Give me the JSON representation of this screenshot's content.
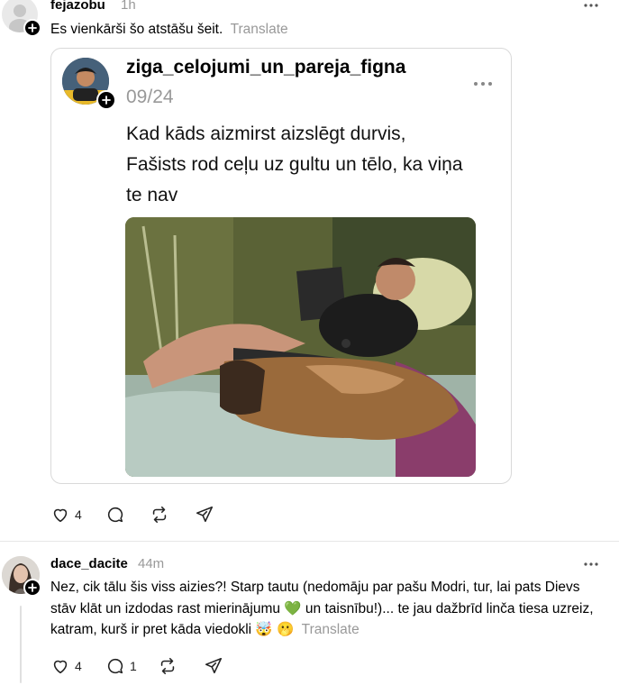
{
  "post1": {
    "username": "fejazobu",
    "time": "1h",
    "text": "Es vienkārši šo atstāšu šeit.",
    "translate": "Translate",
    "quoted": {
      "username": "ziga_celojumi_un_pareja_figna",
      "date": "09/24",
      "text": "Kad kāds aizmirst aizslēgt durvis, Fašists rod ceļu uz gultu un tēlo, ka viņa te nav"
    },
    "actions": {
      "likes": "4"
    }
  },
  "post2": {
    "username": "dace_dacite",
    "time": "44m",
    "text": "Nez, cik tālu šis viss aizies?! Starp tautu (nedomāju par pašu Modri, tur, lai pats Dievs stāv klāt un izdodas rast mierinājumu 💚 un taisnību!)... te jau dažbrīd linča tiesa uzreiz, katram, kurš ir pret kāda viedokli 🤯 🫢",
    "translate": "Translate",
    "actions": {
      "likes": "4",
      "replies": "1"
    }
  },
  "colors": {
    "text": "#000000",
    "muted": "#999999",
    "border": "#d9d9d9"
  }
}
